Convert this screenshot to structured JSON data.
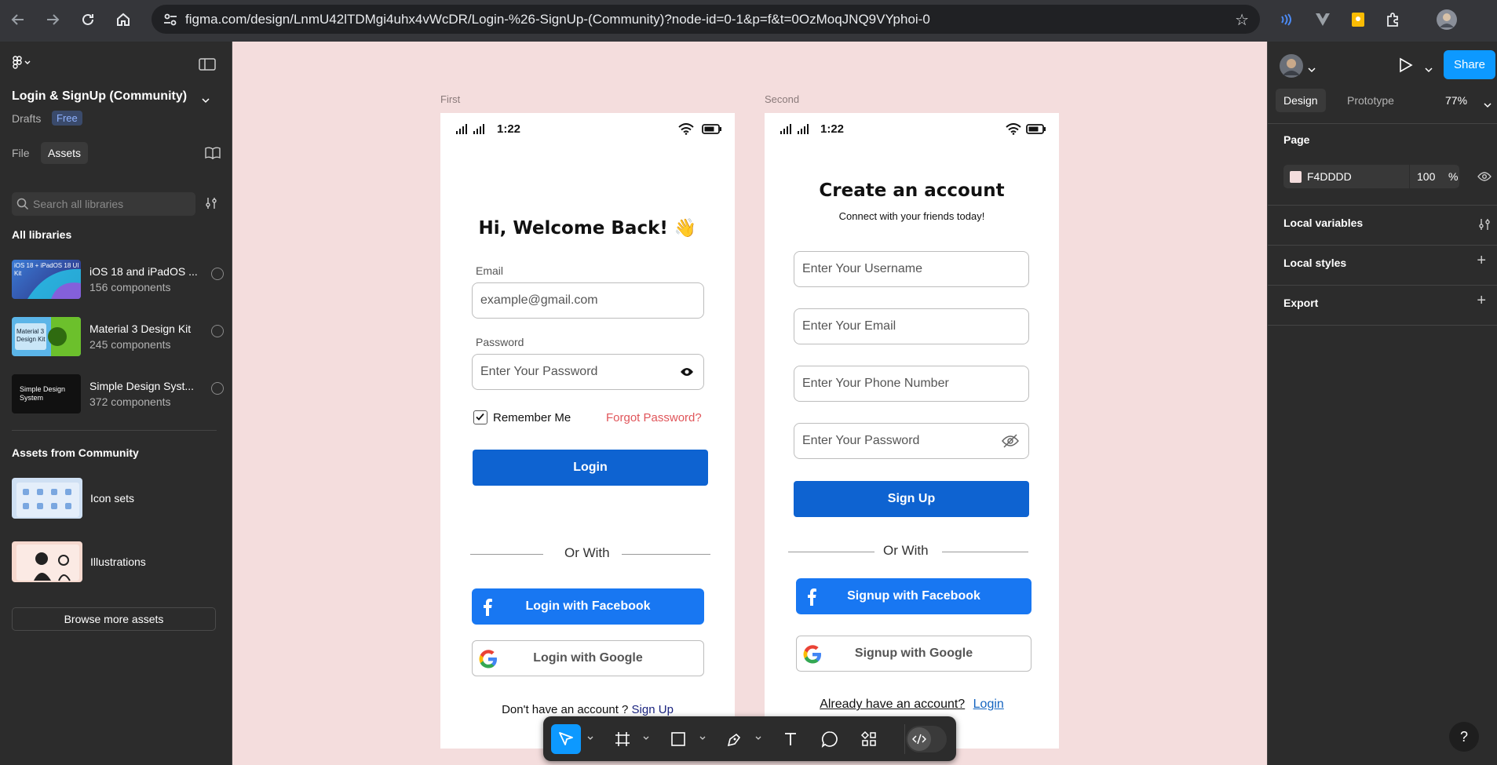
{
  "browser": {
    "url": "figma.com/design/LnmU42lTDMgi4uhx4vWcDR/Login-%26-SignUp-(Community)?node-id=0-1&p=f&t=0OzMoqJNQ9VYphoi-0"
  },
  "left_panel": {
    "file_title": "Login & SignUp (Community)",
    "drafts": "Drafts",
    "plan_badge": "Free",
    "tabs": [
      "File",
      "Assets"
    ],
    "search_placeholder": "Search all libraries",
    "all_libraries": "All libraries",
    "libraries": [
      {
        "name": "iOS 18 and iPadOS ...",
        "count": "156 components",
        "thumb_text": "iOS 18 + iPadOS 18 UI Kit"
      },
      {
        "name": "Material 3 Design Kit",
        "count": "245 components",
        "thumb_text": "Material 3 Design Kit"
      },
      {
        "name": "Simple Design Syst...",
        "count": "372 components",
        "thumb_text": "Simple Design System"
      }
    ],
    "assets_from_community": "Assets from Community",
    "community": [
      {
        "name": "Icon sets"
      },
      {
        "name": "Illustrations"
      }
    ],
    "browse_more": "Browse more assets"
  },
  "canvas": {
    "background": "#F4DDDD",
    "frames": [
      {
        "label": "First",
        "time": "1:22",
        "heading": "Hi, Welcome Back! 👋",
        "email_label": "Email",
        "email_value": "example@gmail.com",
        "password_label": "Password",
        "password_placeholder": "Enter Your Password",
        "remember_me": "Remember Me",
        "forgot_password": "Forgot Password?",
        "login_button": "Login",
        "or_with": "Or With",
        "facebook_button": "Login with Facebook",
        "google_button": "Login with Google",
        "footer_text": "Don't have an account ?",
        "footer_link": "Sign Up"
      },
      {
        "label": "Second",
        "time": "1:22",
        "heading": "Create an account",
        "subheading": "Connect with your friends today!",
        "username_placeholder": "Enter Your Username",
        "email_placeholder": "Enter Your Email",
        "phone_placeholder": "Enter Your Phone Number",
        "password_placeholder": "Enter Your Password",
        "signup_button": "Sign Up",
        "or_with": "Or With",
        "facebook_button": "Signup with Facebook",
        "google_button": "Signup with Google",
        "footer_text": "Already have an account?",
        "footer_link": "Login"
      }
    ]
  },
  "right_panel": {
    "share": "Share",
    "tabs": [
      "Design",
      "Prototype"
    ],
    "zoom": "77%",
    "page_heading": "Page",
    "page_color": "F4DDDD",
    "page_opacity": "100",
    "percent": "%",
    "local_variables": "Local variables",
    "local_styles": "Local styles",
    "export": "Export"
  },
  "help": "?",
  "colors": {
    "accent": "#0D99FF",
    "primary_button": "#0E63D1",
    "facebook": "#1877F2",
    "forgot": "#E0555A",
    "link": "#1565C0"
  }
}
